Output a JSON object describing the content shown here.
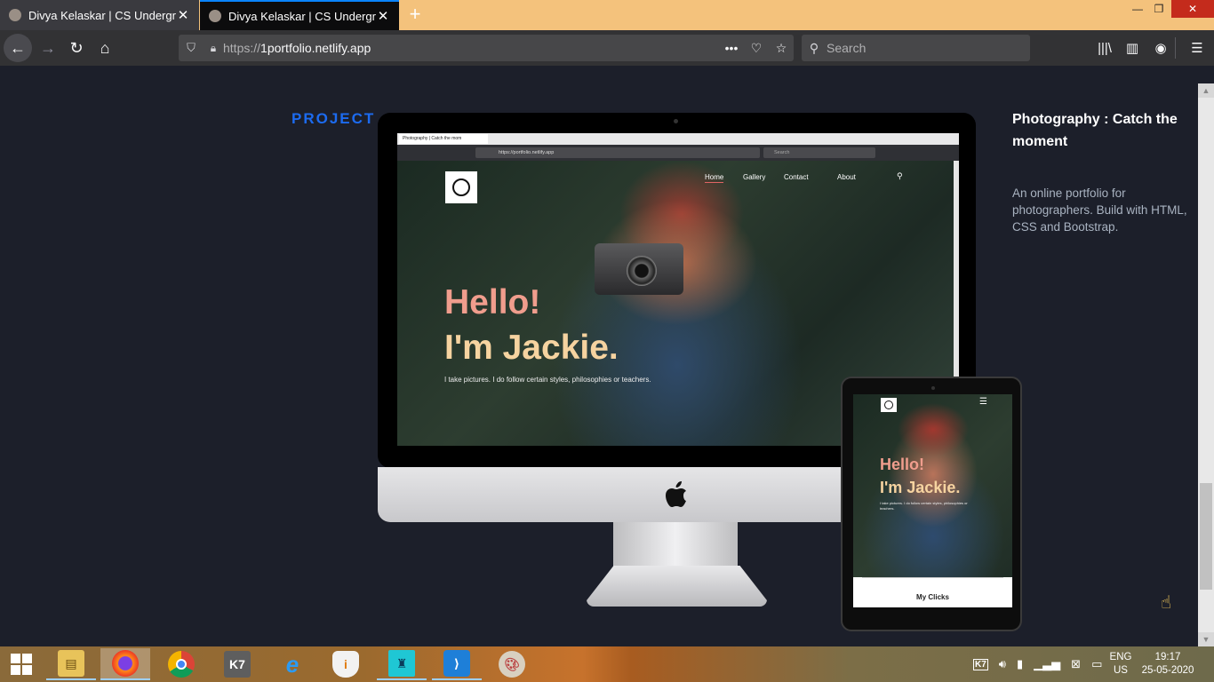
{
  "browser": {
    "tabs": [
      {
        "title": "Divya Kelaskar | CS Undergradu",
        "active": false
      },
      {
        "title": "Divya Kelaskar | CS Undergradu",
        "active": true
      }
    ],
    "url": {
      "protocol": "https://",
      "host": "1portfolio.netlify.app"
    },
    "search_placeholder": "Search",
    "icons": {
      "back": "back-arrow-icon",
      "forward": "forward-arrow-icon",
      "reload": "reload-icon",
      "home": "home-icon",
      "shield": "tracking-shield-icon",
      "lock": "lock-icon",
      "page_actions": "more-dots-icon",
      "pocket": "pocket-icon",
      "bookmark": "star-icon",
      "library": "library-icon",
      "sidebar": "sidebar-icon",
      "account": "account-icon",
      "menu": "hamburger-menu-icon"
    }
  },
  "page": {
    "section_label": "PROJECT",
    "project": {
      "title": "Photography : Catch the moment",
      "description": "An online portfolio for photographers. Build with HTML, CSS and Bootstrap."
    },
    "mockup": {
      "mini_tab_title": "Photography | Catch the mom",
      "mini_url": "https://portfolio.netlify.app",
      "mini_search": "Search",
      "nav": [
        "Home",
        "Gallery",
        "Contact",
        "About"
      ],
      "hero_line1": "Hello!",
      "hero_line2": "I'm Jackie.",
      "hero_sub": "I take pictures. I do follow certain styles, philosophies or teachers.",
      "ipad_sub": "I take pictures. I do follow certain styles, philosophies or teachers.",
      "ipad_footer": "My Clicks"
    }
  },
  "taskbar": {
    "apps": [
      "file-explorer",
      "firefox",
      "chrome",
      "k7-security",
      "internet-explorer",
      "app-shield",
      "app-tile",
      "vscode",
      "paint"
    ],
    "language": {
      "line1": "ENG",
      "line2": "US"
    },
    "clock": {
      "time": "19:17",
      "date": "25-05-2020"
    }
  },
  "colors": {
    "accent": "#1c6bf0",
    "page_bg": "#1c1f2a",
    "hero_pink": "#f09d8d",
    "hero_cream": "#f6d3a0"
  }
}
